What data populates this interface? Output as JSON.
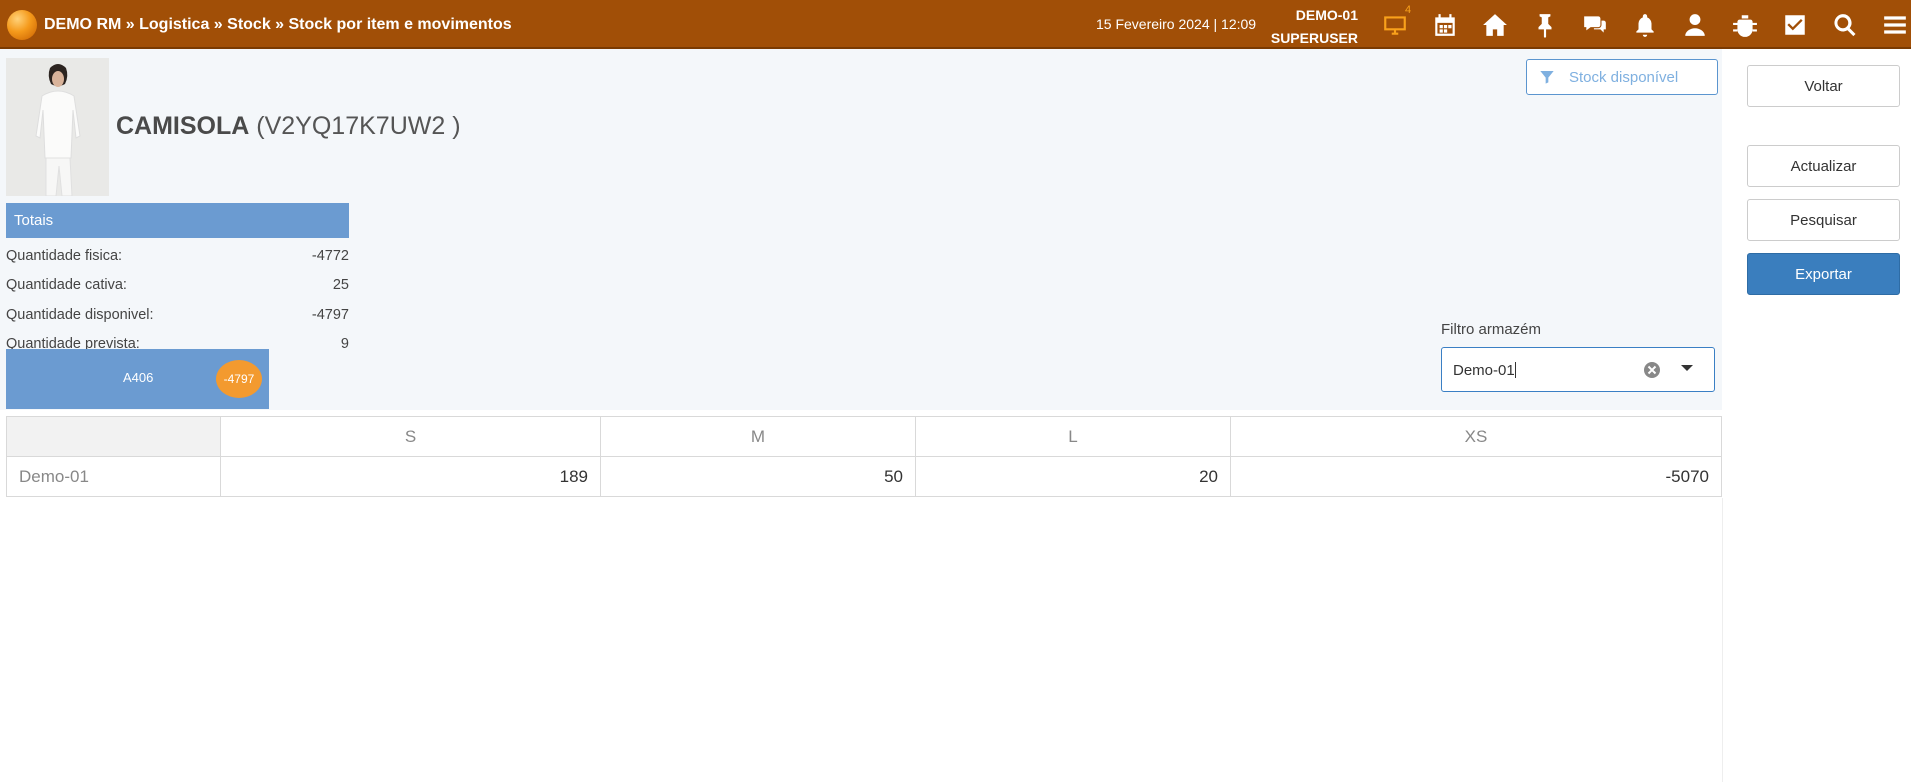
{
  "header": {
    "breadcrumb": "DEMO RM » Logistica » Stock » Stock por item e movimentos",
    "datetime": "15 Fevereiro 2024 | 12:09",
    "company": "DEMO-01",
    "user": "SUPERUSER",
    "monitor_badge": "4",
    "icons": [
      "monitor-icon",
      "calendar-icon",
      "home-icon",
      "pin-icon",
      "chat-icon",
      "bell-icon",
      "user-icon",
      "bug-icon",
      "checkbox-icon",
      "search-icon",
      "menu-icon"
    ]
  },
  "product": {
    "name": "CAMISOLA",
    "code": "(V2YQ17K7UW2 )"
  },
  "stock_filter_button": "Stock disponível",
  "totals": {
    "title": "Totais",
    "rows": [
      {
        "label": "Quantidade fisica:",
        "value": "-4772"
      },
      {
        "label": "Quantidade cativa:",
        "value": "25"
      },
      {
        "label": "Quantidade disponivel:",
        "value": "-4797"
      },
      {
        "label": "Quantidade prevista:",
        "value": "9"
      }
    ]
  },
  "warehouse_tile": {
    "name": "A406",
    "badge": "-4797"
  },
  "warehouse_filter": {
    "label": "Filtro armazém",
    "value": "Demo-01"
  },
  "grid": {
    "columns": [
      "S",
      "M",
      "L",
      "XS"
    ],
    "rows": [
      {
        "label": "Demo-01",
        "values": [
          "189",
          "50",
          "20",
          "-5070"
        ]
      }
    ]
  },
  "actions": {
    "back": "Voltar",
    "refresh": "Actualizar",
    "search": "Pesquisar",
    "export": "Exportar"
  },
  "colors": {
    "topbar": "#a14f07",
    "accent_blue": "#6b9bd1",
    "primary_button": "#3a7ebe",
    "badge_orange": "#f39a2f"
  }
}
